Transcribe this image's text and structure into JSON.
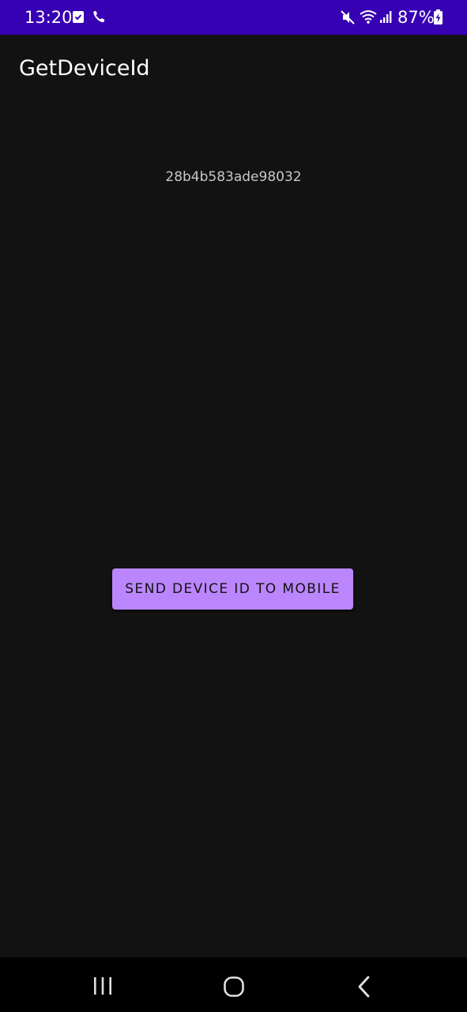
{
  "status_bar": {
    "time": "13:20",
    "battery": "87%",
    "background": "#3700b3",
    "icons": [
      "checkbox-notification-icon",
      "phone-call-icon",
      "mute-icon",
      "wifi-icon",
      "signal-icon",
      "battery-charging-icon"
    ]
  },
  "app": {
    "title": "GetDeviceId",
    "device_id": "28b4b583ade98032",
    "send_button_label": "SEND DEVICE ID TO MOBILE",
    "accent": "#bb86fc",
    "background": "#121212"
  },
  "nav_bar": {
    "buttons": [
      "recent-apps-icon",
      "home-icon",
      "back-icon"
    ]
  }
}
